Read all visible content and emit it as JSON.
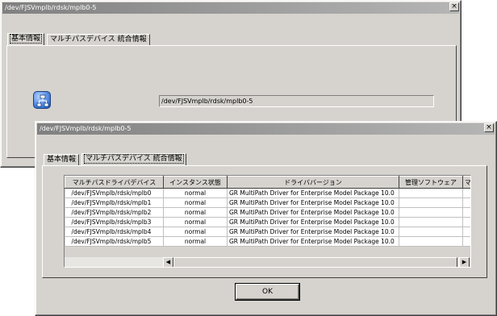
{
  "back_window": {
    "title": "/dev/FJSVmplb/rdsk/mplb0-5",
    "close_glyph": "×",
    "tabs": [
      {
        "label": "基本情報",
        "active": true
      },
      {
        "label": "マルチパスデバイス 統合情報",
        "active": false
      }
    ],
    "device_path_value": "/dev/FJSVmplb/rdsk/mplb0-5",
    "icon": "multipath-device-icon"
  },
  "front_window": {
    "title": "/dev/FJSVmplb/rdsk/mplb0-5",
    "close_glyph": "×",
    "tabs": [
      {
        "label": "基本情報",
        "active": false
      },
      {
        "label": "マルチパスデバイス 統合情報",
        "active": true
      }
    ],
    "table": {
      "columns": [
        "マルチパスドライバデバイス",
        "インスタンス状態",
        "ドライババージョン",
        "管理ソフトウェア",
        "マ"
      ],
      "rows": [
        [
          "/dev/FJSVmplb/rdsk/mplb0",
          "normal",
          "GR MultiPath Driver for Enterprise Model Package 10.0",
          "",
          ""
        ],
        [
          "/dev/FJSVmplb/rdsk/mplb1",
          "normal",
          "GR MultiPath Driver for Enterprise Model Package 10.0",
          "",
          ""
        ],
        [
          "/dev/FJSVmplb/rdsk/mplb2",
          "normal",
          "GR MultiPath Driver for Enterprise Model Package 10.0",
          "",
          ""
        ],
        [
          "/dev/FJSVmplb/rdsk/mplb3",
          "normal",
          "GR MultiPath Driver for Enterprise Model Package 10.0",
          "",
          ""
        ],
        [
          "/dev/FJSVmplb/rdsk/mplb4",
          "normal",
          "GR MultiPath Driver for Enterprise Model Package 10.0",
          "",
          ""
        ],
        [
          "/dev/FJSVmplb/rdsk/mplb5",
          "normal",
          "GR MultiPath Driver for Enterprise Model Package 10.0",
          "",
          ""
        ]
      ]
    },
    "scroll_left_glyph": "◀",
    "scroll_right_glyph": "▶",
    "ok_label": "OK"
  },
  "colors": {
    "dialog_bg": "#d6d3ce",
    "titlebar_start": "#808080",
    "titlebar_end": "#b5b5b5",
    "icon_blue": "#3a78d8"
  }
}
